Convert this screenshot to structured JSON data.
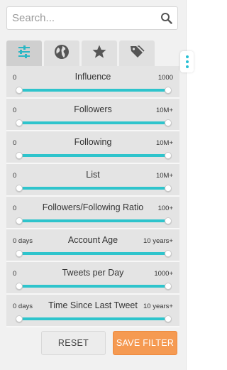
{
  "search": {
    "placeholder": "Search...",
    "value": ""
  },
  "tabs": [
    {
      "icon": "sliders-icon",
      "active": true
    },
    {
      "icon": "globe-icon",
      "active": false
    },
    {
      "icon": "star-icon",
      "active": false
    },
    {
      "icon": "tag-icon",
      "active": false
    }
  ],
  "filters": [
    {
      "label": "Influence",
      "min": "0",
      "max": "1000"
    },
    {
      "label": "Followers",
      "min": "0",
      "max": "10M+"
    },
    {
      "label": "Following",
      "min": "0",
      "max": "10M+"
    },
    {
      "label": "List",
      "min": "0",
      "max": "10M+"
    },
    {
      "label": "Followers/Following Ratio",
      "min": "0",
      "max": "100+"
    },
    {
      "label": "Account Age",
      "min": "0 days",
      "max": "10 years+"
    },
    {
      "label": "Tweets per Day",
      "min": "0",
      "max": "1000+"
    },
    {
      "label": "Time Since Last Tweet",
      "min": "0 days",
      "max": "10 years+"
    }
  ],
  "buttons": {
    "reset": "RESET",
    "save": "SAVE FILTER"
  },
  "colors": {
    "accent": "#2ec4cc",
    "save": "#f59a52",
    "panel": "#f1f1f1"
  }
}
